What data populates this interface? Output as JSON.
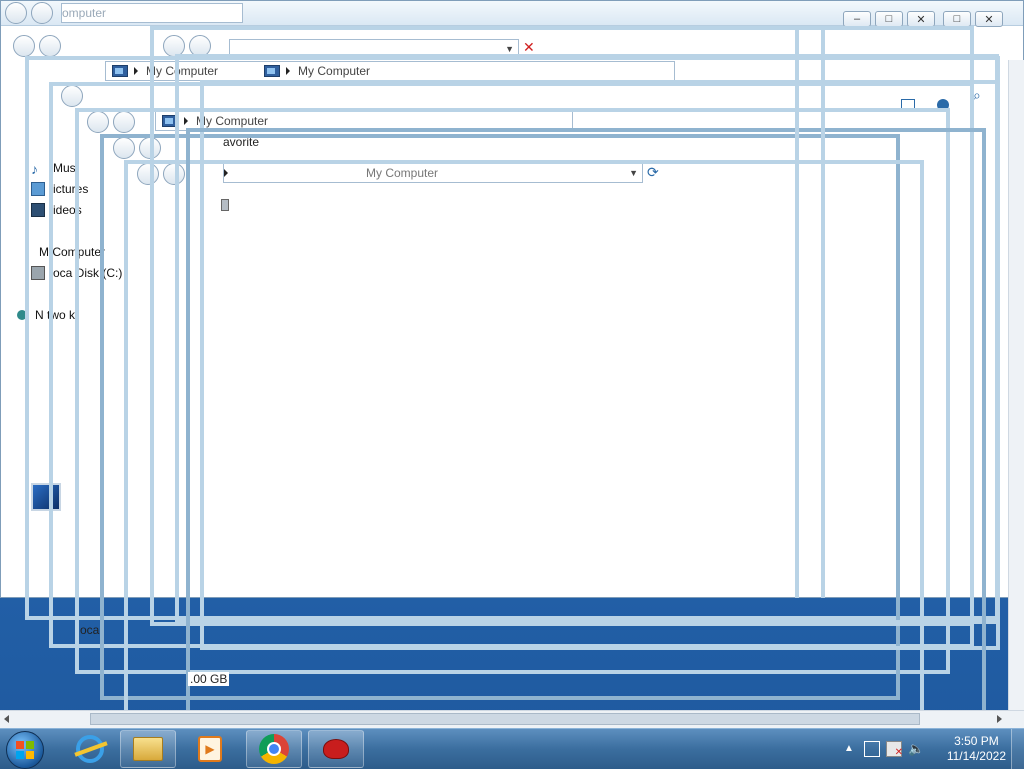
{
  "window": {
    "breadcrumb_back": "My Computer",
    "breadcrumb_primary": "My Computer",
    "breadcrumb_secondary": "My Computer",
    "breadcrumb_ghost_top": "omputer",
    "address_ghost": "My Computer",
    "favorites_fragment": "avorite",
    "drive_size_fragment": ".00 GB",
    "drive_label_fragment": "oca"
  },
  "sidebar": {
    "items": [
      {
        "label": "Musi",
        "icon": "music-icon"
      },
      {
        "label": "ictures",
        "icon": "pictures-icon"
      },
      {
        "label": "ideos",
        "icon": "videos-icon"
      },
      {
        "label": "M Computer",
        "icon": "computer-icon"
      },
      {
        "label": "oca Disk (C:)",
        "icon": "local-disk-icon"
      },
      {
        "label": "N two k",
        "icon": "network-icon"
      }
    ]
  },
  "taskbar": {
    "apps": [
      {
        "name": "Internet Explorer",
        "icon": "ie-icon"
      },
      {
        "name": "Windows Explorer",
        "icon": "explorer-icon"
      },
      {
        "name": "Windows Media Player",
        "icon": "media-player-icon"
      },
      {
        "name": "Google Chrome",
        "icon": "chrome-icon"
      },
      {
        "name": "App",
        "icon": "red-app-icon"
      }
    ],
    "clock_time": "3:50 PM",
    "clock_date": "11/14/2022"
  },
  "colors": {
    "desktop": "#2565ae",
    "frame": "#b9d3e6",
    "taskbar": "#3b6e9f"
  }
}
